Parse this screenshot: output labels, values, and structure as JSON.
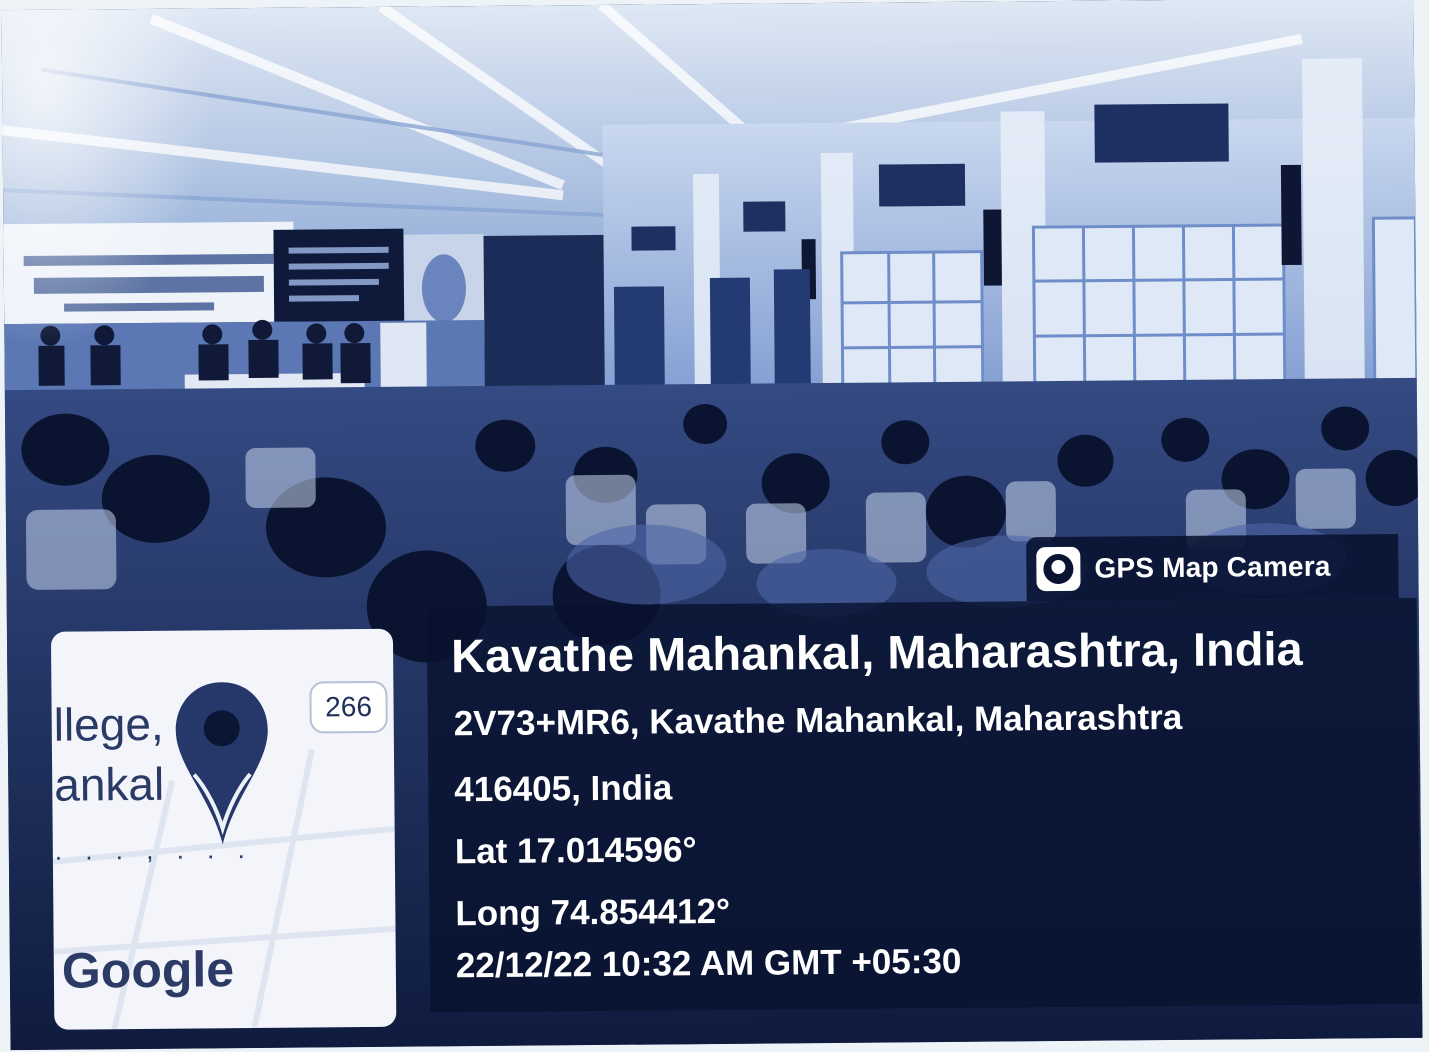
{
  "badge": {
    "label": "GPS Map Camera",
    "icon": "camera-icon"
  },
  "location": {
    "title": "Kavathe Mahankal, Maharashtra, India",
    "address_line1": "2V73+MR6, Kavathe Mahankal, Maharashtra",
    "address_line2": "416405, India",
    "lat": "Lat 17.014596°",
    "long": "Long 74.854412°",
    "datetime": "22/12/22 10:32 AM GMT +05:30"
  },
  "map": {
    "label_line1": "llege,",
    "label_line2": "ankal",
    "road_badge": "266",
    "brand": "Google",
    "pin_icon": "map-pin-icon",
    "dots": ". . .     , . . ."
  },
  "colors": {
    "overlay": "#08122f",
    "scene_tint": "#6f8ec9"
  }
}
